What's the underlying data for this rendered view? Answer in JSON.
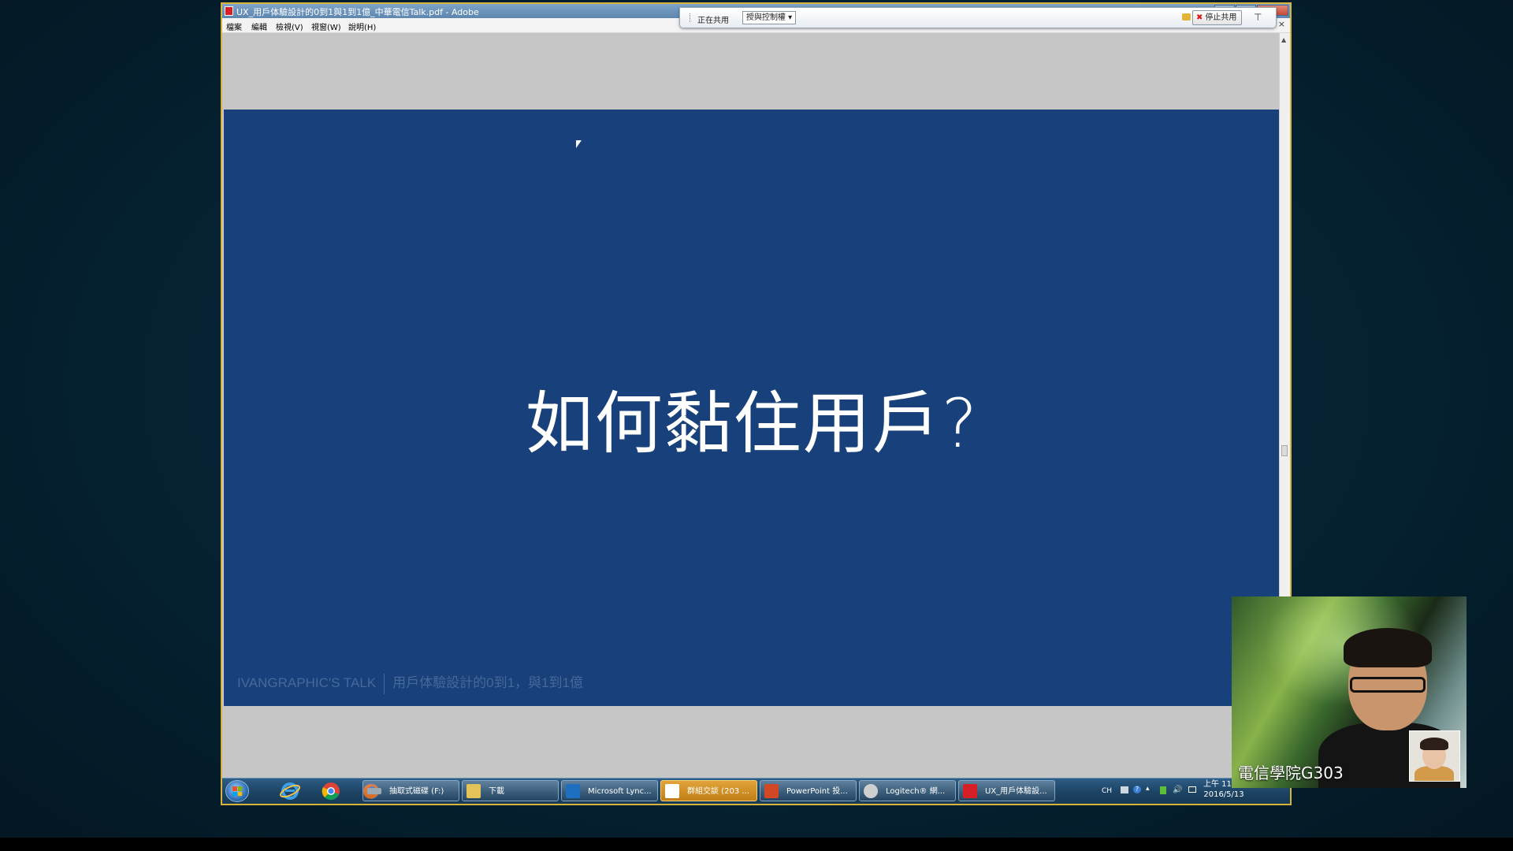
{
  "window": {
    "title": "UX_用戶体驗設計的0到1與1到1億_中華電信Talk.pdf - Adobe",
    "minimize": "—",
    "maximize": "□",
    "close": "✕"
  },
  "menubar": {
    "items": [
      "檔案",
      "編輯",
      "檢視(V)",
      "視窗(W)",
      "說明(H)"
    ],
    "doc_close": "×"
  },
  "share_toolbar": {
    "sharing_label": "正在共用",
    "control_dropdown": "授與控制權 ▾",
    "stop_button": "停止共用",
    "stop_icon": "✖",
    "pin_icon": "pushpin-icon"
  },
  "slide": {
    "title": "如何黏住用戶?",
    "footer_brand": "IVANGRAPHIC'S TALK",
    "footer_subtitle": "用戶体驗設計的0到1，與1到1億",
    "background_color": "#18407a"
  },
  "taskbar": {
    "pinned": [
      "internet-explorer-icon",
      "chrome-icon",
      "firefox-icon"
    ],
    "tasks": [
      {
        "label": "抽取式磁碟 (F:)",
        "icon": "drive-icon",
        "color": "#9aa8b4"
      },
      {
        "label": "下載",
        "icon": "folder-icon",
        "color": "#e4c25a"
      },
      {
        "label": "Microsoft Lync...",
        "icon": "lync-icon",
        "color": "#1f6fc0"
      },
      {
        "label": "群組交談 (203 ...",
        "icon": "chat-icon",
        "color": "#ffffff"
      },
      {
        "label": "PowerPoint 投...",
        "icon": "powerpoint-icon",
        "color": "#d24726"
      },
      {
        "label": "Logitech® 網...",
        "icon": "logitech-icon",
        "color": "#cfcfcf"
      },
      {
        "label": "UX_用戶体驗設...",
        "icon": "pdf-icon",
        "color": "#d71f26"
      }
    ],
    "active_task_index": 3,
    "tray_lang": "CH",
    "clock_time": "上午 11:02",
    "clock_date": "2016/5/13"
  },
  "webcam": {
    "name_label": "電信學院G303"
  }
}
